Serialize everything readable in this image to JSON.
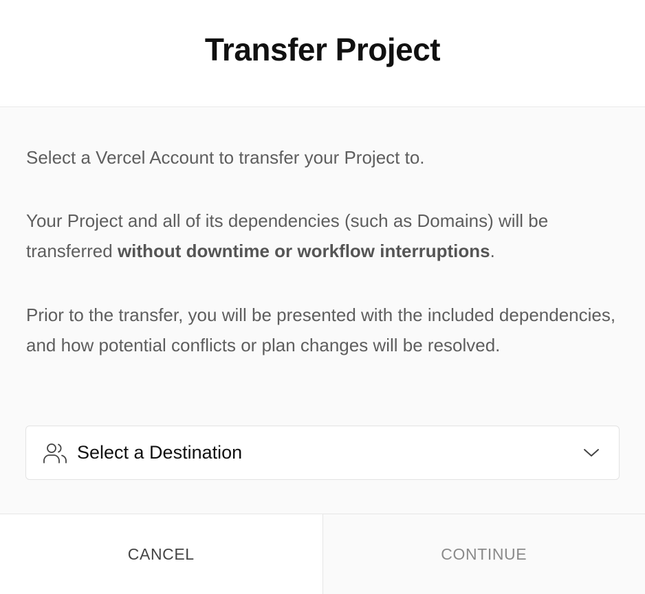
{
  "dialog": {
    "title": "Transfer Project"
  },
  "body": {
    "paragraph1": "Select a Vercel Account to transfer your Project to.",
    "paragraph2_prefix": "Your Project and all of its dependencies (such as Domains) will be transferred ",
    "paragraph2_bold": "without downtime or workflow interruptions",
    "paragraph2_suffix": ".",
    "paragraph3": "Prior to the transfer, you will be presented with the included dependencies, and how potential conflicts or plan changes will be resolved."
  },
  "destination_select": {
    "icon": "users-icon",
    "placeholder": "Select a Destination",
    "chevron": "chevron-down-icon"
  },
  "footer": {
    "cancel_label": "CANCEL",
    "continue_label": "CONTINUE"
  },
  "colors": {
    "text_primary": "#111111",
    "text_secondary": "#5e5e5e",
    "border": "#e6e6e6",
    "body_bg": "#fafafa"
  }
}
